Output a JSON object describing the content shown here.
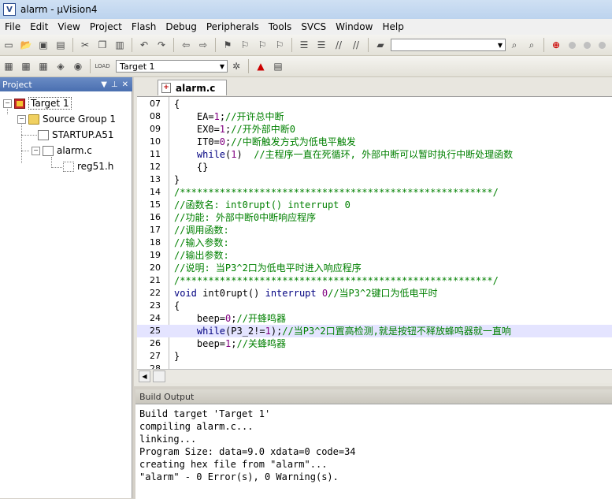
{
  "window": {
    "title": "alarm - µVision4"
  },
  "menu": [
    "File",
    "Edit",
    "View",
    "Project",
    "Flash",
    "Debug",
    "Peripherals",
    "Tools",
    "SVCS",
    "Window",
    "Help"
  ],
  "toolbar": {
    "target_select": "Target 1",
    "load_label": "LOAD"
  },
  "project": {
    "header": "Project",
    "tree": {
      "target": "Target 1",
      "group": "Source Group 1",
      "files": [
        "STARTUP.A51",
        "alarm.c"
      ],
      "header": "reg51.h"
    }
  },
  "editor": {
    "tab": "alarm.c",
    "lines": [
      {
        "n": "07",
        "t": "{",
        "c": "p"
      },
      {
        "n": "08",
        "t": "    EA=1;//开许总中断",
        "c": "m"
      },
      {
        "n": "09",
        "t": "    EX0=1;//开外部中断0",
        "c": "m"
      },
      {
        "n": "10",
        "t": "    IT0=0;//中断触发方式为低电平触发",
        "c": "m"
      },
      {
        "n": "11",
        "t": "    while(1)  //主程序一直在死循环, 外部中断可以暂时执行中断处理函数",
        "c": "w"
      },
      {
        "n": "12",
        "t": "    {}",
        "c": "p"
      },
      {
        "n": "13",
        "t": "}",
        "c": "p"
      },
      {
        "n": "14",
        "t": "/*******************************************************/",
        "c": "c"
      },
      {
        "n": "15",
        "t": "//函数名: int0rupt() interrupt 0",
        "c": "c"
      },
      {
        "n": "16",
        "t": "//功能: 外部中断0中断响应程序",
        "c": "c"
      },
      {
        "n": "17",
        "t": "//调用函数:",
        "c": "c"
      },
      {
        "n": "18",
        "t": "//输入参数:",
        "c": "c"
      },
      {
        "n": "19",
        "t": "//输出参数:",
        "c": "c"
      },
      {
        "n": "20",
        "t": "//说明: 当P3^2口为低电平时进入响应程序",
        "c": "c"
      },
      {
        "n": "21",
        "t": "/*******************************************************/",
        "c": "c"
      },
      {
        "n": "22",
        "t": "void int0rupt() interrupt 0//当P3^2键口为低电平时",
        "c": "f"
      },
      {
        "n": "23",
        "t": "{",
        "c": "p"
      },
      {
        "n": "24",
        "t": "    beep=0;//开蜂鸣器",
        "c": "m"
      },
      {
        "n": "25",
        "t": "    while(P3_2!=1);//当P3^2口置高检测,就是按钮不释放蜂鸣器就一直响",
        "c": "w2"
      },
      {
        "n": "26",
        "t": "    beep=1;//关蜂鸣器",
        "c": "m"
      },
      {
        "n": "27",
        "t": "}",
        "c": "p"
      },
      {
        "n": "28",
        "t": "",
        "c": "p"
      }
    ]
  },
  "build": {
    "header": "Build Output",
    "lines": [
      "Build target 'Target 1'",
      "compiling alarm.c...",
      "linking...",
      "Program Size: data=9.0 xdata=0 code=34",
      "creating hex file from \"alarm\"...",
      "\"alarm\" - 0 Error(s), 0 Warning(s)."
    ]
  }
}
